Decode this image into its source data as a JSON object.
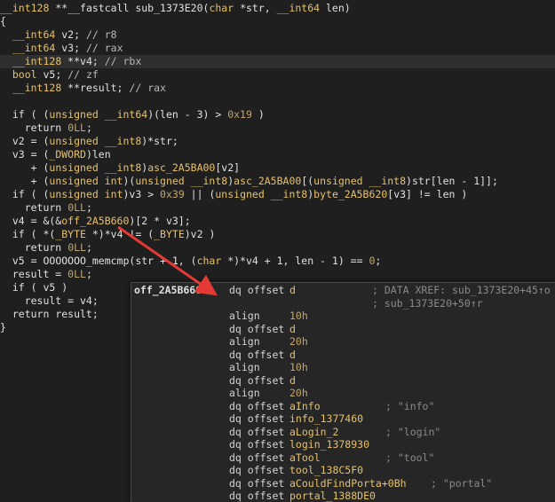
{
  "code": {
    "lines": [
      {
        "id": "l0",
        "segs": [
          [
            "t-type",
            "__int128"
          ],
          [
            "t-p",
            " **"
          ],
          [
            "t-fn",
            "__fastcall sub_1373E20"
          ],
          [
            "t-p",
            "("
          ],
          [
            "t-type",
            "char"
          ],
          [
            "t-p",
            " *str, "
          ],
          [
            "t-type",
            "__int64"
          ],
          [
            "t-p",
            " len)"
          ]
        ]
      },
      {
        "id": "l1",
        "segs": [
          [
            "t-p",
            "{"
          ]
        ]
      },
      {
        "id": "l2",
        "segs": [
          [
            "t-p",
            "  "
          ],
          [
            "t-type",
            "__int64"
          ],
          [
            "t-p",
            " v2; "
          ],
          [
            "t-cm",
            "// r8"
          ]
        ]
      },
      {
        "id": "l3",
        "segs": [
          [
            "t-p",
            "  "
          ],
          [
            "t-type",
            "__int64"
          ],
          [
            "t-p",
            " v3; "
          ],
          [
            "t-cm",
            "// rax"
          ]
        ]
      },
      {
        "id": "l4",
        "segs": [
          [
            "t-p",
            "  "
          ],
          [
            "t-type",
            "__int128"
          ],
          [
            "t-p",
            " **v4; "
          ],
          [
            "t-cm",
            "// rbx"
          ]
        ]
      },
      {
        "id": "l5",
        "segs": [
          [
            "t-p",
            "  "
          ],
          [
            "t-type",
            "bool"
          ],
          [
            "t-p",
            " v5; "
          ],
          [
            "t-cm",
            "// zf"
          ]
        ]
      },
      {
        "id": "l6",
        "segs": [
          [
            "t-p",
            "  "
          ],
          [
            "t-type",
            "__int128"
          ],
          [
            "t-p",
            " **result; "
          ],
          [
            "t-cm",
            "// rax"
          ]
        ]
      },
      {
        "id": "l7",
        "segs": [
          [
            "t-p",
            ""
          ]
        ]
      },
      {
        "id": "l8",
        "segs": [
          [
            "t-k",
            "  if"
          ],
          [
            "t-p",
            " ( ("
          ],
          [
            "t-type",
            "unsigned __int64"
          ],
          [
            "t-p",
            ")(len - 3) > "
          ],
          [
            "t-num",
            "0x19"
          ],
          [
            "t-p",
            " )"
          ]
        ]
      },
      {
        "id": "l9",
        "segs": [
          [
            "t-k",
            "    return"
          ],
          [
            "t-p",
            " "
          ],
          [
            "t-num",
            "0LL"
          ],
          [
            "t-p",
            ";"
          ]
        ]
      },
      {
        "id": "l10",
        "segs": [
          [
            "t-p",
            "  v2 = ("
          ],
          [
            "t-type",
            "unsigned __int8"
          ],
          [
            "t-p",
            ")*str;"
          ]
        ]
      },
      {
        "id": "l11",
        "segs": [
          [
            "t-p",
            "  v3 = ("
          ],
          [
            "t-type",
            "_DWORD"
          ],
          [
            "t-p",
            ")len"
          ]
        ]
      },
      {
        "id": "l12",
        "segs": [
          [
            "t-p",
            "     + ("
          ],
          [
            "t-type",
            "unsigned __int8"
          ],
          [
            "t-p",
            ")"
          ],
          [
            "t-gl",
            "asc_2A5BA00"
          ],
          [
            "t-p",
            "[v2]"
          ]
        ]
      },
      {
        "id": "l13",
        "segs": [
          [
            "t-p",
            "     + ("
          ],
          [
            "t-type",
            "unsigned int"
          ],
          [
            "t-p",
            ")("
          ],
          [
            "t-type",
            "unsigned __int8"
          ],
          [
            "t-p",
            ")"
          ],
          [
            "t-gl",
            "asc_2A5BA00"
          ],
          [
            "t-p",
            "[("
          ],
          [
            "t-type",
            "unsigned __int8"
          ],
          [
            "t-p",
            ")str[len - 1]];"
          ]
        ]
      },
      {
        "id": "l14",
        "segs": [
          [
            "t-k",
            "  if"
          ],
          [
            "t-p",
            " ( ("
          ],
          [
            "t-type",
            "unsigned int"
          ],
          [
            "t-p",
            ")v3 > "
          ],
          [
            "t-num",
            "0x39"
          ],
          [
            "t-p",
            " || ("
          ],
          [
            "t-type",
            "unsigned __int8"
          ],
          [
            "t-p",
            ")"
          ],
          [
            "t-gl",
            "byte_2A5B620"
          ],
          [
            "t-p",
            "[v3] != len )"
          ]
        ]
      },
      {
        "id": "l15",
        "segs": [
          [
            "t-k",
            "    return"
          ],
          [
            "t-p",
            " "
          ],
          [
            "t-num",
            "0LL"
          ],
          [
            "t-p",
            ";"
          ]
        ]
      },
      {
        "id": "l16",
        "segs": [
          [
            "t-p",
            "  v4 = &(&"
          ],
          [
            "t-gl",
            "off_2A5B660"
          ],
          [
            "t-p",
            ")[2 * v3];"
          ]
        ]
      },
      {
        "id": "l17",
        "segs": [
          [
            "t-k",
            "  if"
          ],
          [
            "t-p",
            " ( *("
          ],
          [
            "t-type",
            "_BYTE"
          ],
          [
            "t-p",
            " *)*v4 != ("
          ],
          [
            "t-type",
            "_BYTE"
          ],
          [
            "t-p",
            ")v2 )"
          ]
        ]
      },
      {
        "id": "l18",
        "segs": [
          [
            "t-k",
            "    return"
          ],
          [
            "t-p",
            " "
          ],
          [
            "t-num",
            "0LL"
          ],
          [
            "t-p",
            ";"
          ]
        ]
      },
      {
        "id": "l19",
        "segs": [
          [
            "t-p",
            "  v5 = "
          ],
          [
            "t-fn",
            "OOOOOOO_memcmp"
          ],
          [
            "t-p",
            "(str + 1, ("
          ],
          [
            "t-type",
            "char"
          ],
          [
            "t-p",
            " *)*v4 + 1, len - 1) == "
          ],
          [
            "t-num",
            "0"
          ],
          [
            "t-p",
            ";"
          ]
        ]
      },
      {
        "id": "l20",
        "segs": [
          [
            "t-p",
            "  result = "
          ],
          [
            "t-num",
            "0LL"
          ],
          [
            "t-p",
            ";"
          ]
        ]
      },
      {
        "id": "l21",
        "segs": [
          [
            "t-k",
            "  if"
          ],
          [
            "t-p",
            " ( v5 )"
          ]
        ]
      },
      {
        "id": "l22",
        "segs": [
          [
            "t-p",
            "    result = v4;"
          ]
        ]
      },
      {
        "id": "l23",
        "segs": [
          [
            "t-k",
            "  return"
          ],
          [
            "t-p",
            " result;"
          ]
        ]
      },
      {
        "id": "l24",
        "segs": [
          [
            "t-p",
            "}"
          ]
        ]
      }
    ]
  },
  "popup": {
    "rows": [
      {
        "label": "off_2A5B660",
        "instr": "dq offset",
        "arg": "d",
        "comment": "; DATA XREF: sub_1373E20+45↑o"
      },
      {
        "label": "",
        "instr": "",
        "arg": "",
        "comment": "; sub_1373E20+50↑r"
      },
      {
        "label": "",
        "instr": "align",
        "arg": "10h",
        "comment": ""
      },
      {
        "label": "",
        "instr": "dq offset",
        "arg": "d",
        "comment": ""
      },
      {
        "label": "",
        "instr": "align",
        "arg": "20h",
        "comment": ""
      },
      {
        "label": "",
        "instr": "dq offset",
        "arg": "d",
        "comment": ""
      },
      {
        "label": "",
        "instr": "align",
        "arg": "10h",
        "comment": ""
      },
      {
        "label": "",
        "instr": "dq offset",
        "arg": "d",
        "comment": ""
      },
      {
        "label": "",
        "instr": "align",
        "arg": "20h",
        "comment": ""
      },
      {
        "label": "",
        "instr": "dq offset",
        "arg": "aInfo",
        "comment": "; \"info\""
      },
      {
        "label": "",
        "instr": "dq offset",
        "arg": "info_1377460",
        "comment": ""
      },
      {
        "label": "",
        "instr": "dq offset",
        "arg": "aLogin_2",
        "comment": "; \"login\""
      },
      {
        "label": "",
        "instr": "dq offset",
        "arg": "login_1378930",
        "comment": ""
      },
      {
        "label": "",
        "instr": "dq offset",
        "arg": "aTool",
        "comment": "; \"tool\""
      },
      {
        "label": "",
        "instr": "dq offset",
        "arg": "tool_138C5F0",
        "comment": ""
      },
      {
        "label": "",
        "instr": "dq offset",
        "arg": "aCouldFindPorta+0Bh",
        "comment": "; \"portal\""
      },
      {
        "label": "",
        "instr": "dq offset",
        "arg": "portal_1388DE0",
        "comment": ""
      }
    ]
  },
  "colors": {
    "background": "#1f1f1f",
    "type": "#e6c16b",
    "number": "#c3a66a",
    "comment": "#8a8a8a",
    "arrow": "#e53935"
  }
}
